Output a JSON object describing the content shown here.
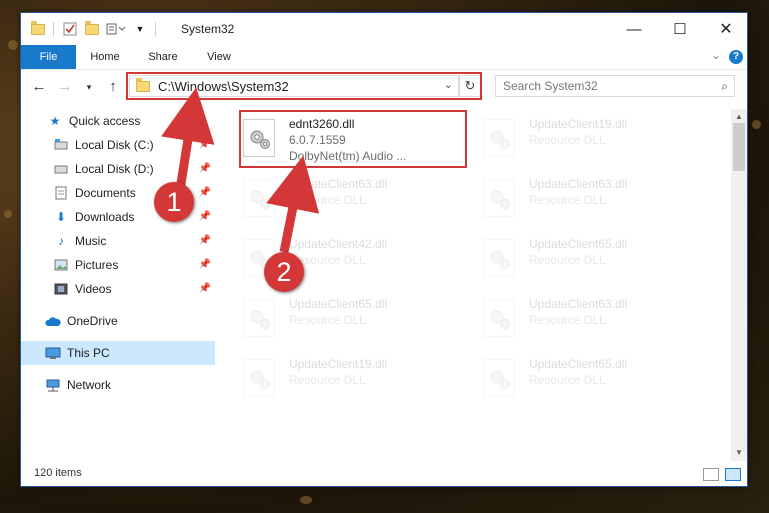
{
  "window": {
    "title": "System32"
  },
  "ribbon": {
    "tabs": [
      "File",
      "Home",
      "Share",
      "View"
    ],
    "help": "?"
  },
  "address": {
    "path": "C:\\Windows\\System32"
  },
  "search": {
    "placeholder": "Search System32"
  },
  "sidebar": {
    "items": [
      {
        "label": "Quick access",
        "icon": "star-icon"
      },
      {
        "label": "Local Disk (C:)",
        "icon": "drive-icon",
        "pinned": true
      },
      {
        "label": "Local Disk (D:)",
        "icon": "drive-icon",
        "pinned": true
      },
      {
        "label": "Documents",
        "icon": "documents-icon",
        "pinned": true
      },
      {
        "label": "Downloads",
        "icon": "download-icon",
        "pinned": true
      },
      {
        "label": "Music",
        "icon": "music-icon",
        "pinned": true
      },
      {
        "label": "Pictures",
        "icon": "pictures-icon",
        "pinned": true
      },
      {
        "label": "Videos",
        "icon": "videos-icon",
        "pinned": true
      },
      {
        "label": "OneDrive",
        "icon": "cloud-icon"
      },
      {
        "label": "This PC",
        "icon": "computer-icon",
        "selected": true
      },
      {
        "label": "Network",
        "icon": "network-icon"
      }
    ]
  },
  "files": [
    {
      "name": "ednt3260.dll",
      "version": "6.0.7.1559",
      "description": "DolbyNet(tm) Audio ..."
    },
    {
      "name": "UpdateClient19.dll",
      "description": "Resource DLL"
    },
    {
      "name": "UpdateClient63.dll",
      "description": "Resource DLL"
    },
    {
      "name": "UpdateClient63.dll",
      "description": "Resource DLL"
    },
    {
      "name": "UpdateClient42.dll",
      "description": "Resource DLL"
    },
    {
      "name": "UpdateClient65.dll",
      "description": "Resource DLL"
    },
    {
      "name": "UpdateClient65.dll",
      "description": "Resource DLL"
    },
    {
      "name": "UpdateClient63.dll",
      "description": "Resource DLL"
    },
    {
      "name": "UpdateClient19.dll",
      "description": "Resource DLL"
    },
    {
      "name": "UpdateClient65.dll",
      "description": "Resource DLL"
    }
  ],
  "status": {
    "count": "120 items"
  },
  "annotations": {
    "marker1": "1",
    "marker2": "2"
  },
  "colors": {
    "accent": "#1979ca",
    "highlight": "#d23838",
    "selection": "#cce8ff"
  }
}
